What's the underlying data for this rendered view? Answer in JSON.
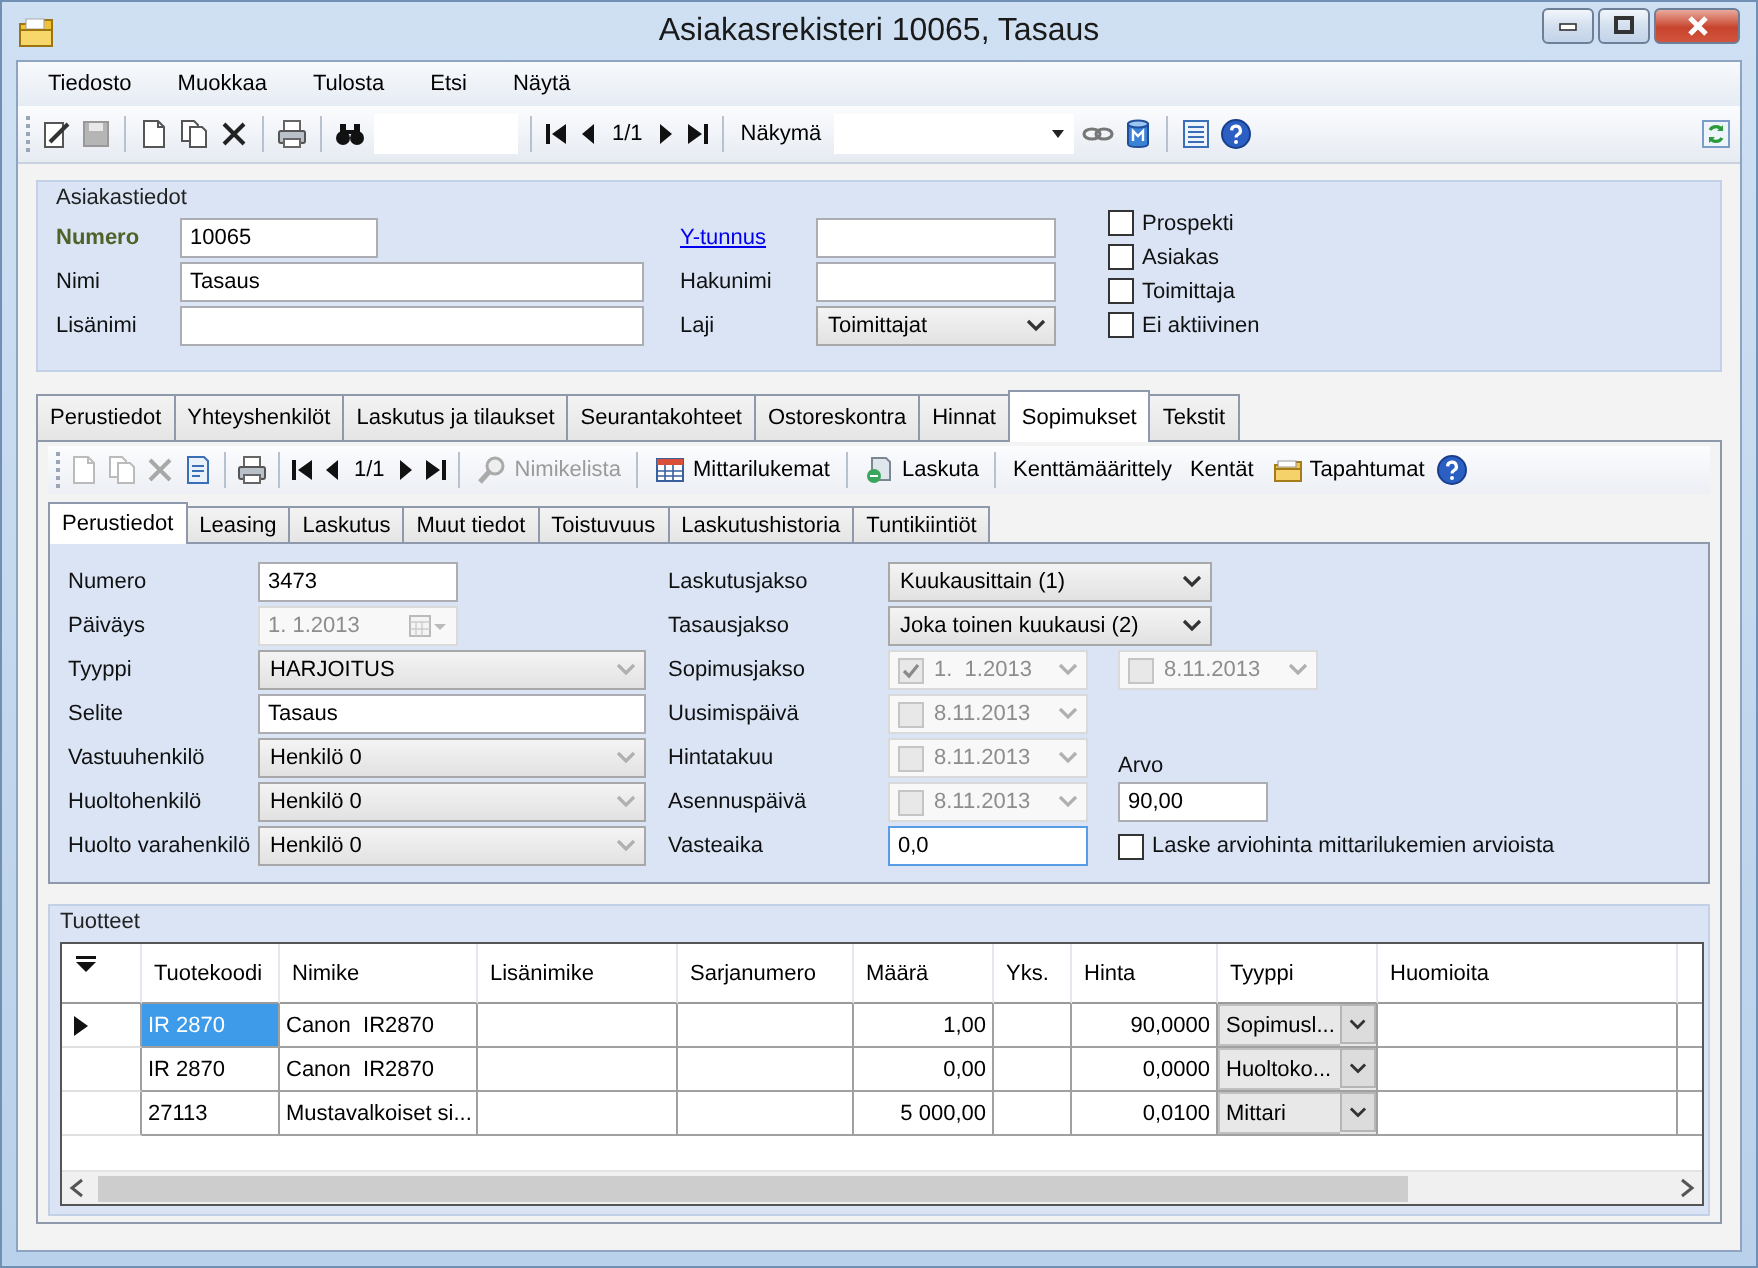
{
  "window": {
    "title": "Asiakasrekisteri 10065, Tasaus"
  },
  "menu": [
    "Tiedosto",
    "Muokkaa",
    "Tulosta",
    "Etsi",
    "Näytä"
  ],
  "toolbar": {
    "page": "1/1",
    "view_label": "Näkymä"
  },
  "customer": {
    "title": "Asiakastiedot",
    "numero": {
      "label": "Numero",
      "value": "10065"
    },
    "nimi": {
      "label": "Nimi",
      "value": "Tasaus"
    },
    "lisanimi": {
      "label": "Lisänimi"
    },
    "ytunnus": {
      "label": "Y-tunnus"
    },
    "hakunimi": {
      "label": "Hakunimi"
    },
    "laji": {
      "label": "Laji",
      "value": "Toimittajat"
    },
    "roles": [
      {
        "label": "Prospekti",
        "checked": false
      },
      {
        "label": "Asiakas",
        "checked": false
      },
      {
        "label": "Toimittaja",
        "checked": false
      },
      {
        "label": "Ei aktiivinen",
        "checked": false
      }
    ]
  },
  "tabs": [
    {
      "label": "Perustiedot",
      "selected": false
    },
    {
      "label": "Yhteyshenkilöt",
      "selected": false
    },
    {
      "label": "Laskutus ja tilaukset",
      "selected": false
    },
    {
      "label": "Seurantakohteet",
      "selected": false
    },
    {
      "label": "Ostoreskontra",
      "selected": false
    },
    {
      "label": "Hinnat",
      "selected": false
    },
    {
      "label": "Sopimukset",
      "selected": true
    },
    {
      "label": "Tekstit",
      "selected": false
    }
  ],
  "contract_toolbar": {
    "page": "1/1",
    "buttons": [
      {
        "label": "Nimikelista",
        "disabled": true
      },
      {
        "label": "Mittarilukemat",
        "disabled": false
      },
      {
        "label": "Laskuta",
        "disabled": false
      },
      {
        "label": "Kenttämäärittely",
        "disabled": false
      },
      {
        "label": "Kentät",
        "disabled": false
      },
      {
        "label": "Tapahtumat",
        "disabled": false
      }
    ]
  },
  "subtabs": [
    {
      "label": "Perustiedot",
      "selected": true
    },
    {
      "label": "Leasing",
      "selected": false
    },
    {
      "label": "Laskutus",
      "selected": false
    },
    {
      "label": "Muut tiedot",
      "selected": false
    },
    {
      "label": "Toistuvuus",
      "selected": false
    },
    {
      "label": "Laskutushistoria",
      "selected": false
    },
    {
      "label": "Tuntikiintiöt",
      "selected": false
    }
  ],
  "contract": {
    "left": [
      {
        "kind": "number",
        "label": "Numero",
        "value": "3473"
      },
      {
        "kind": "date",
        "label": "Päiväys",
        "value": "1. 1.2013",
        "disabled": true
      },
      {
        "kind": "select",
        "label": "Tyyppi",
        "value": "HARJOITUS"
      },
      {
        "kind": "text",
        "label": "Selite",
        "value": "Tasaus"
      },
      {
        "kind": "select",
        "label": "Vastuuhenkilö",
        "value": "Henkilö 0"
      },
      {
        "kind": "select",
        "label": "Huoltohenkilö",
        "value": "Henkilö 0"
      },
      {
        "kind": "select",
        "label": "Huolto varahenkilö",
        "value": "Henkilö 0"
      }
    ],
    "right": [
      {
        "kind": "select",
        "label": "Laskutusjakso",
        "value": "Kuukausittain (1)"
      },
      {
        "kind": "select",
        "label": "Tasausjakso",
        "value": "Joka toinen kuukausi (2)"
      },
      {
        "kind": "daterange",
        "label": "Sopimusjakso",
        "disabled": true,
        "start": {
          "value": "1.  1.2013",
          "checked": true
        },
        "end": {
          "value": "8.11.2013",
          "checked": false
        }
      },
      {
        "kind": "date",
        "label": "Uusimispäivä",
        "disabled": true,
        "value": "8.11.2013",
        "checked": false
      },
      {
        "kind": "date",
        "label": "Hintatakuu",
        "disabled": true,
        "value": "8.11.2013",
        "checked": false
      },
      {
        "kind": "date",
        "label": "Asennuspäivä",
        "disabled": true,
        "value": "8.11.2013",
        "checked": false
      },
      {
        "kind": "text",
        "label": "Vasteaika",
        "value": "0,0",
        "focused": true
      }
    ],
    "arvo": {
      "label": "Arvo",
      "value": "90,00"
    },
    "estimate": {
      "label": "Laske arviohinta mittarilukemien arvioista",
      "checked": false
    }
  },
  "products": {
    "title": "Tuotteet",
    "columns": [
      "Tuotekoodi",
      "Nimike",
      "Lisänimike",
      "Sarjanumero",
      "Määrä",
      "Yks.",
      "Hinta",
      "Tyyppi",
      "Huomioita"
    ],
    "rows": [
      {
        "selected": true,
        "code": "IR 2870",
        "name": "Canon  IR2870",
        "quantity": "1,00",
        "price": "90,0000",
        "type": "Sopimusl..."
      },
      {
        "selected": false,
        "code": "IR 2870",
        "name": "Canon  IR2870",
        "quantity": "0,00",
        "price": "0,0000",
        "type": "Huoltoko..."
      },
      {
        "selected": false,
        "code": "27113",
        "name": "Mustavalkoiset si...",
        "quantity": "5 000,00",
        "price": "0,0100",
        "type": "Mittari"
      }
    ]
  }
}
